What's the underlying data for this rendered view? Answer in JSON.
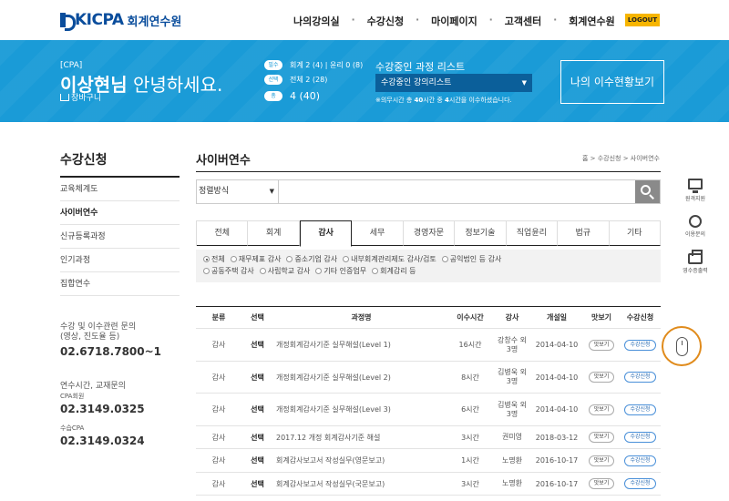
{
  "header": {
    "logo_text": "KICPA",
    "logo_sub": "회계연수원",
    "nav": [
      "나의강의실",
      "수강신청",
      "마이페이지",
      "고객센터",
      "회계연수원"
    ],
    "logout": "LOGOUT"
  },
  "banner": {
    "tag": "[CPA]",
    "name": "이상현님",
    "greeting": "안녕하세요.",
    "cart": "장바구니",
    "stats": [
      {
        "badge": "필수",
        "text": "회계 2 (4) | 윤리 0 (8)"
      },
      {
        "badge": "선택",
        "text": "전체 2 (28)"
      },
      {
        "badge": "총",
        "text": "4 (40)"
      }
    ],
    "list_title": "수강중인 과정 리스트",
    "list_select": "수강중인 강의리스트",
    "note_pre": "※의무시간 총 ",
    "note_total": "40",
    "note_mid": "시간 중 ",
    "note_done": "4",
    "note_post": "시간을 이수하셨습니다.",
    "history_button": "나의 이수현황보기"
  },
  "sidebar": {
    "title": "수강신청",
    "items": [
      "교육체계도",
      "사이버연수",
      "신규등록과정",
      "인기과정",
      "집합연수"
    ],
    "active_index": 1,
    "contacts": [
      {
        "label1": "수강 및 이수관련 문의",
        "label2": "(영상, 진도율 등)",
        "sub": "",
        "number": "02.6718.7800~1"
      },
      {
        "label1": "연수시간, 교재문의",
        "label2": "",
        "sub": "CPA회원",
        "number": "02.3149.0325"
      },
      {
        "label1": "",
        "label2": "",
        "sub": "수습CPA",
        "number": "02.3149.0324"
      }
    ]
  },
  "main": {
    "title": "사이버연수",
    "breadcrumb": "홈 > 수강신청 > 사이버연수",
    "sort_label": "정렬방식",
    "search_placeholder": "",
    "tabs": [
      "전체",
      "회계",
      "감사",
      "세무",
      "경영자문",
      "정보기술",
      "직업윤리",
      "법규",
      "기타"
    ],
    "active_tab": 2,
    "filters_row1": [
      "전체",
      "재무제표 감사",
      "중소기업 감사",
      "내부회계관리제도 감사/검토",
      "공익법인 등 감사"
    ],
    "filters_row2": [
      "공동주택 감사",
      "사립학교 감사",
      "기타 인증업무",
      "회계감리 등"
    ],
    "grid_headers": [
      "분류",
      "선택",
      "과정명",
      "이수시간",
      "강사",
      "개설일",
      "맛보기",
      "수강신청"
    ],
    "rows": [
      {
        "cat": "감사",
        "sel": "선택",
        "name": "개정회계감사기준 실무해설(Level 1)",
        "hours": "16시간",
        "teacher1": "강창수 외",
        "teacher2": "3명",
        "date": "2014-04-10",
        "preview": "맛보기",
        "apply": "수강신청"
      },
      {
        "cat": "감사",
        "sel": "선택",
        "name": "개정회계감사기준 실무해설(Level 2)",
        "hours": "8시간",
        "teacher1": "김병욱 외",
        "teacher2": "3명",
        "date": "2014-04-10",
        "preview": "맛보기",
        "apply": "수강신청"
      },
      {
        "cat": "감사",
        "sel": "선택",
        "name": "개정회계감사기준 실무해설(Level 3)",
        "hours": "6시간",
        "teacher1": "김병욱 외",
        "teacher2": "3명",
        "date": "2014-04-10",
        "preview": "맛보기",
        "apply": "수강신청"
      },
      {
        "cat": "감사",
        "sel": "선택",
        "name": "2017.12 개정 회계감사기준 해설",
        "hours": "3시간",
        "teacher1": "권미영",
        "teacher2": "",
        "date": "2018-03-12",
        "preview": "맛보기",
        "apply": "수강신청"
      },
      {
        "cat": "감사",
        "sel": "선택",
        "name": "회계감사보고서 작성실무(영문보고)",
        "hours": "1시간",
        "teacher1": "노명환",
        "teacher2": "",
        "date": "2016-10-17",
        "preview": "맛보기",
        "apply": "수강신청"
      },
      {
        "cat": "감사",
        "sel": "선택",
        "name": "회계감사보고서 작성실무(국문보고)",
        "hours": "3시간",
        "teacher1": "노명환",
        "teacher2": "",
        "date": "2016-10-17",
        "preview": "맛보기",
        "apply": "수강신청"
      }
    ]
  },
  "quick": {
    "remote": "원격지원",
    "inquiry": "이용문의",
    "receipt": "영수증출력"
  }
}
